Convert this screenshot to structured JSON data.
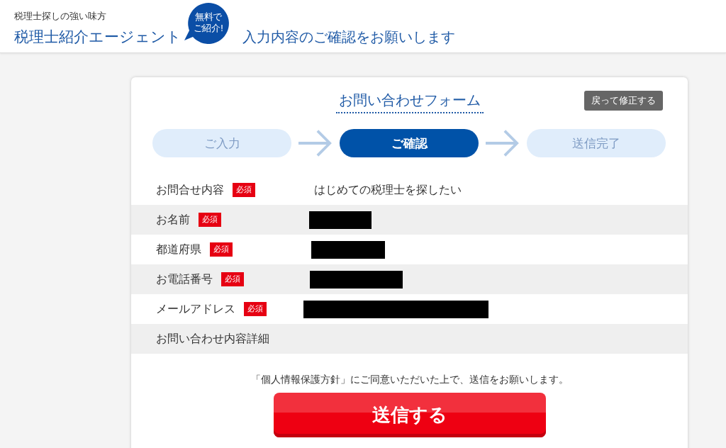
{
  "header": {
    "tagline": "税理士探しの強い味方",
    "site_title": "税理士紹介エージェント",
    "free_badge": {
      "lines": [
        "無料で",
        "ご紹介!"
      ]
    },
    "page_heading": "入力内容のご確認をお願いします"
  },
  "form": {
    "title": "お問い合わせフォーム",
    "back_button": "戻って修正する",
    "steps": [
      {
        "label": "ご入力",
        "selected": false
      },
      {
        "label": "ご確認",
        "selected": true
      },
      {
        "label": "送信完了",
        "selected": false
      }
    ],
    "fields": [
      {
        "label": "お問合せ内容",
        "badge": "必須",
        "kind": "text",
        "value": "はじめての税理士を探したい"
      },
      {
        "label": "お名前",
        "badge": "必須",
        "kind": "redacted"
      },
      {
        "label": "都道府県",
        "badge": "必須",
        "kind": "redacted"
      },
      {
        "label": "お電話番号",
        "badge": "必須",
        "kind": "redacted"
      },
      {
        "label": "メールアドレス",
        "badge": "必須",
        "kind": "redacted"
      },
      {
        "label": "お問い合わせ内容詳細",
        "kind": "empty"
      }
    ],
    "consent_note": "「個人情報保護方針」にご同意いただいた上で、送信をお願いします。",
    "submit_button": "送信する"
  }
}
